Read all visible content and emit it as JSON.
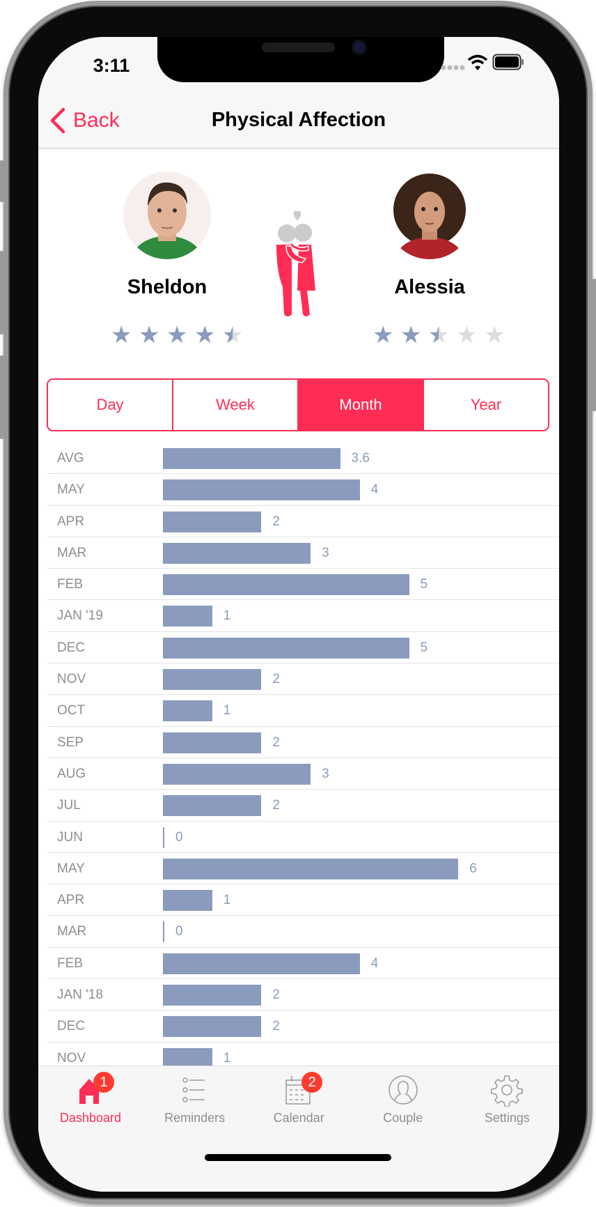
{
  "status": {
    "time": "3:11"
  },
  "nav": {
    "back_label": "Back",
    "title": "Physical Affection"
  },
  "partners": [
    {
      "name": "Sheldon",
      "rating": 4.5
    },
    {
      "name": "Alessia",
      "rating": 2.5
    }
  ],
  "colors": {
    "accent": "#ff2d55",
    "bar": "#8a9bbd",
    "badge": "#ff3b30"
  },
  "segments": {
    "items": [
      "Day",
      "Week",
      "Month",
      "Year"
    ],
    "selected": "Month"
  },
  "rows": [
    {
      "label": "AVG",
      "value": 3.6
    },
    {
      "label": "MAY",
      "value": 4
    },
    {
      "label": "APR",
      "value": 2
    },
    {
      "label": "MAR",
      "value": 3
    },
    {
      "label": "FEB",
      "value": 5
    },
    {
      "label": "JAN '19",
      "value": 1
    },
    {
      "label": "DEC",
      "value": 5
    },
    {
      "label": "NOV",
      "value": 2
    },
    {
      "label": "OCT",
      "value": 1
    },
    {
      "label": "SEP",
      "value": 2
    },
    {
      "label": "AUG",
      "value": 3
    },
    {
      "label": "JUL",
      "value": 2
    },
    {
      "label": "JUN",
      "value": 0
    },
    {
      "label": "MAY",
      "value": 6
    },
    {
      "label": "APR",
      "value": 1
    },
    {
      "label": "MAR",
      "value": 0
    },
    {
      "label": "FEB",
      "value": 4
    },
    {
      "label": "JAN '18",
      "value": 2
    },
    {
      "label": "DEC",
      "value": 2
    },
    {
      "label": "NOV",
      "value": 1
    }
  ],
  "tabs": [
    {
      "label": "Dashboard",
      "icon": "home-icon",
      "badge": "1",
      "active": true
    },
    {
      "label": "Reminders",
      "icon": "list-icon"
    },
    {
      "label": "Calendar",
      "icon": "calendar-icon",
      "badge": "2"
    },
    {
      "label": "Couple",
      "icon": "person-circle-icon"
    },
    {
      "label": "Settings",
      "icon": "gear-icon"
    }
  ]
}
